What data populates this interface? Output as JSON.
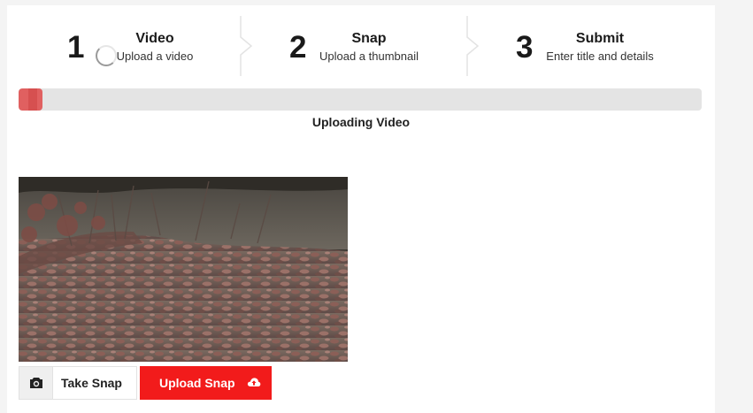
{
  "steps": [
    {
      "number": "1",
      "title": "Video",
      "subtitle": "Upload a video"
    },
    {
      "number": "2",
      "title": "Snap",
      "subtitle": "Upload a thumbnail"
    },
    {
      "number": "3",
      "title": "Submit",
      "subtitle": "Enter title and details"
    }
  ],
  "upload": {
    "progress_fraction": 0.035,
    "status": "Uploading Video"
  },
  "actions": {
    "take_snap_label": "Take Snap",
    "upload_snap_label": "Upload Snap"
  },
  "colors": {
    "accent": "#f21b1b",
    "progress_fill": "#e06060",
    "progress_track": "#e4e4e4"
  },
  "icons": {
    "camera": "camera-icon",
    "cloud_upload": "cloud-upload-icon",
    "spinner": "loading-spinner-icon"
  }
}
